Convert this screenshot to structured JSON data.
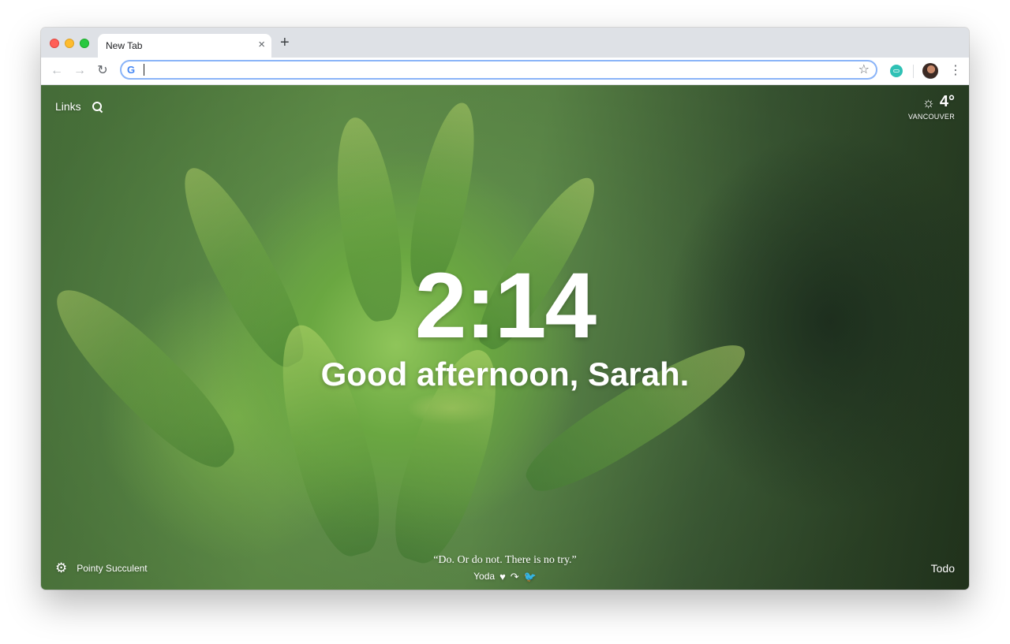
{
  "tab": {
    "title": "New Tab",
    "close_glyph": "×"
  },
  "toolbar": {
    "new_tab_glyph": "+",
    "back_glyph": "←",
    "forward_glyph": "→",
    "reload_glyph": "↻",
    "omnibox_value": "",
    "google_glyph": "G",
    "star_glyph": "☆",
    "menu_glyph": "⋮"
  },
  "header": {
    "links_label": "Links"
  },
  "weather": {
    "icon": "sun-icon",
    "sun_glyph": "☼",
    "temperature": "4°",
    "location": "VANCOUVER"
  },
  "main": {
    "time": "2:14",
    "greeting": "Good afternoon, Sarah."
  },
  "footer": {
    "settings_icon": "gear-icon",
    "gear_glyph": "⚙",
    "photo_name": "Pointy Succulent",
    "quote": "“Do. Or do not. There is no try.”",
    "quote_author": "Yoda",
    "heart_glyph": "♥",
    "skip_glyph": "↷",
    "twitter_glyph": "🐦",
    "todo_label": "Todo"
  },
  "colors": {
    "omnibox_focus": "#8ab4f8",
    "extension_teal": "#2fc1b5",
    "traffic_red": "#ff5f57",
    "traffic_yellow": "#febc2e",
    "traffic_green": "#28c840"
  }
}
